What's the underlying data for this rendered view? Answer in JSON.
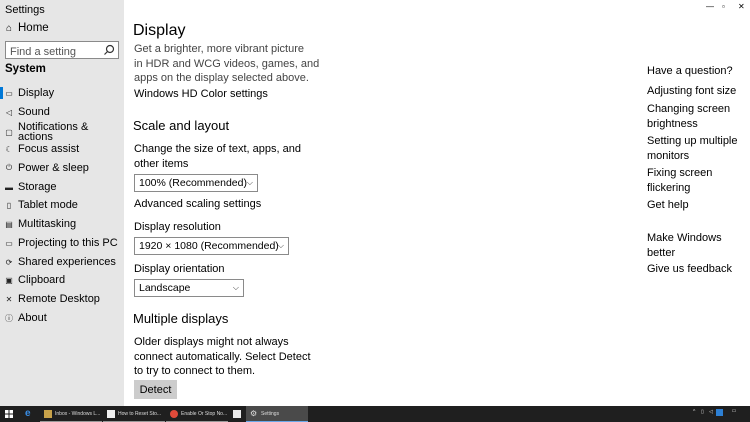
{
  "window": {
    "title": "Settings",
    "controls": [
      "minimize-icon",
      "maximize-icon",
      "close-icon"
    ]
  },
  "sidebar": {
    "home_label": "Home",
    "search_placeholder": "Find a setting",
    "section_heading": "System",
    "items": [
      {
        "label": "Display",
        "icon": "monitor-icon",
        "active": true
      },
      {
        "label": "Sound",
        "icon": "speaker-icon"
      },
      {
        "label": "Notifications & actions",
        "icon": "notification-icon"
      },
      {
        "label": "Focus assist",
        "icon": "moon-icon"
      },
      {
        "label": "Power & sleep",
        "icon": "power-icon"
      },
      {
        "label": "Storage",
        "icon": "storage-icon"
      },
      {
        "label": "Tablet mode",
        "icon": "tablet-icon"
      },
      {
        "label": "Multitasking",
        "icon": "multitasking-icon"
      },
      {
        "label": "Projecting to this PC",
        "icon": "projecting-icon"
      },
      {
        "label": "Shared experiences",
        "icon": "shared-icon"
      },
      {
        "label": "Clipboard",
        "icon": "clipboard-icon"
      },
      {
        "label": "Remote Desktop",
        "icon": "remote-desktop-icon"
      },
      {
        "label": "About",
        "icon": "info-icon"
      }
    ]
  },
  "main": {
    "title": "Display",
    "hdr_text_lines": [
      "Get a brighter, more vibrant picture",
      "in HDR and WCG videos, games, and",
      "apps on the display selected above."
    ],
    "hdr_link": "Windows HD Color settings",
    "scale_heading": "Scale and layout",
    "scale_label_lines": [
      "Change the size of text, apps, and",
      "other items"
    ],
    "scale_value": "100% (Recommended)",
    "advanced_link": "Advanced scaling settings",
    "resolution_label": "Display resolution",
    "resolution_value": "1920 × 1080 (Recommended)",
    "orientation_label": "Display orientation",
    "orientation_value": "Landscape",
    "multiple_heading": "Multiple displays",
    "multiple_text_lines": [
      "Older displays might not always",
      "connect automatically. Select Detect",
      "to try to connect to them."
    ],
    "detect_button": "Detect"
  },
  "help": {
    "heading": "Have a question?",
    "links": [
      {
        "lines": [
          "Adjusting font size"
        ]
      },
      {
        "lines": [
          "Changing screen",
          "brightness"
        ]
      },
      {
        "lines": [
          "Setting up multiple",
          "monitors"
        ]
      },
      {
        "lines": [
          "Fixing screen",
          "flickering"
        ]
      },
      {
        "lines": [
          "Get help"
        ]
      }
    ],
    "better_heading_lines": [
      "Make Windows",
      "better"
    ],
    "feedback_link": "Give us feedback"
  },
  "taskbar": {
    "apps": [
      {
        "label": "Inbox - Windows L...",
        "icon": "mail-icon"
      },
      {
        "label": "How to Reset Sto...",
        "icon": "document-icon"
      },
      {
        "label": "Enable Or Stop No...",
        "icon": "chrome-icon"
      },
      {
        "label": "",
        "icon": "phone-icon"
      },
      {
        "label": "Settings",
        "icon": "gear-icon",
        "active": true
      }
    ],
    "accent": "#0078d7"
  }
}
